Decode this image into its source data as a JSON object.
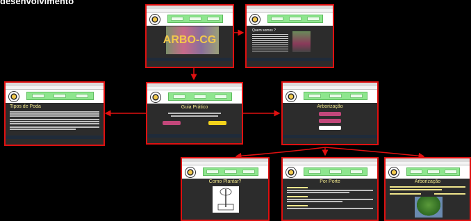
{
  "heading": "desenvolvimento",
  "screens": {
    "home": {
      "logo_text": "ARBO-CG"
    },
    "about": {
      "title": "Quem somos ?"
    },
    "guide": {
      "title": "Guia Prático"
    },
    "pruning": {
      "title": "Tipos de Poda"
    },
    "arborization": {
      "title": "Arborização"
    },
    "planting": {
      "title": "Como Plantar?"
    },
    "size": {
      "title": "Por Porte"
    },
    "arborization2": {
      "title": "Arborização"
    }
  },
  "colors": {
    "border": "#e01010",
    "nav": "#8ee68e",
    "title": "#f0e68c",
    "background": "#2c2c2c"
  }
}
